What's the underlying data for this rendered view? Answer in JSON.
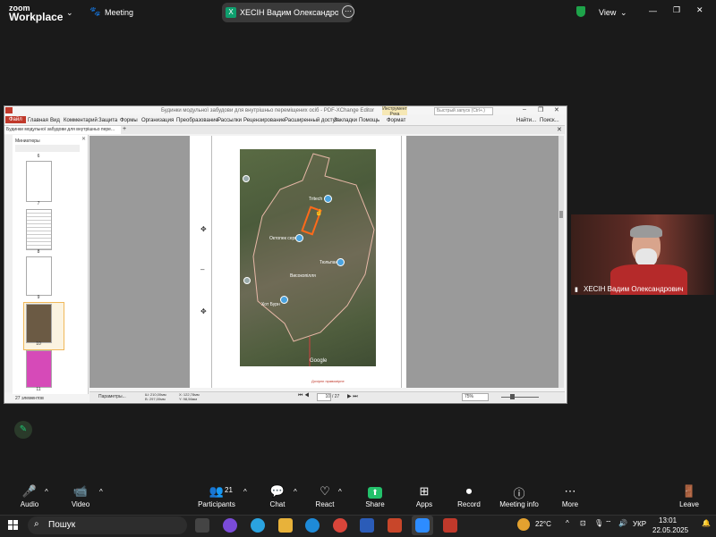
{
  "zoom_top": {
    "logo_line1": "zoom",
    "logo_line2": "Workplace",
    "meeting_label": "Meeting",
    "share_title": "ХЕСІН Вадим Олександрович's s",
    "share_badge": "X",
    "view_label": "View",
    "more_glyph": "⋯"
  },
  "pdf_editor": {
    "title": "Будинки модульної забудови для внутрішньо переміщених осіб - PDF-XChange Editor",
    "context_tab": "Инструмент Рука",
    "search_placeholder": "Быстрый запуск (Ctrl+.)",
    "menu": [
      "Файл",
      "Главная",
      "Вид",
      "Комментарий",
      "Защита",
      "Формы",
      "Организация",
      "Преобразование",
      "Рассылки",
      "Рецензирование",
      "Расширенный доступ",
      "Закладки",
      "Помощь",
      "Формат"
    ],
    "find_label": "Найти...",
    "search_label": "Поиск...",
    "doc_tab": "Будинки модульної забудови для внутрішньо пере...",
    "thumbnails_label": "Миниатюры",
    "page_numbers": [
      "6",
      "7",
      "8",
      "9",
      "10",
      "11"
    ],
    "element_count": "27 элементов",
    "status_params": "Параметры...",
    "status_w": "Ш: 210,00мм",
    "status_h": "В: 297,00мм",
    "status_x": "X: 122,78мм",
    "status_y": "Y: 98,56мм",
    "current_page": "10",
    "total_pages": "/ 27",
    "zoom_level": "75%",
    "map_labels": [
      "Tritech",
      "Октопек сервис",
      "Тюльпан",
      "Високопілля",
      "Хот Бурн",
      "Google"
    ],
    "footer_note": "Дочірнє правомірне"
  },
  "video_tile": {
    "name": "ХЕСІН Вадим Олександрович"
  },
  "controls": [
    {
      "label": "Audio",
      "icon": "🎤"
    },
    {
      "label": "Video",
      "icon": "📹"
    },
    {
      "label": "Participants",
      "icon": "👥",
      "count": "21"
    },
    {
      "label": "Chat",
      "icon": "💬"
    },
    {
      "label": "React",
      "icon": "♡"
    },
    {
      "label": "Share",
      "icon": "⬆"
    },
    {
      "label": "Apps",
      "icon": "⊞"
    },
    {
      "label": "Record",
      "icon": "⏺"
    },
    {
      "label": "Meeting info",
      "icon": "ⓘ"
    },
    {
      "label": "More",
      "icon": "⋯"
    },
    {
      "label": "Leave",
      "icon": "🚪"
    }
  ],
  "taskbar": {
    "search_text": "Пошук",
    "temperature": "22°C",
    "language": "УКР",
    "time": "13:01",
    "date": "22.05.2025"
  }
}
